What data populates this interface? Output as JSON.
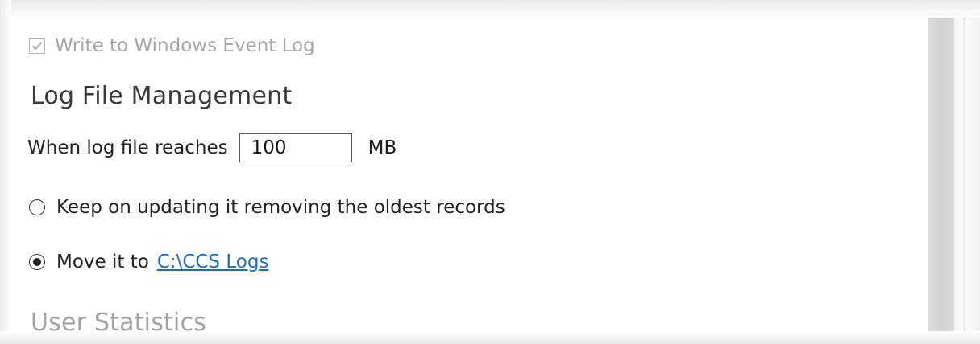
{
  "event_log": {
    "label": "Write to Windows Event Log",
    "checked": true,
    "enabled": false
  },
  "log_file_management": {
    "title": "Log File Management",
    "size_label": "When log file reaches",
    "size_value": "100",
    "size_unit": "MB",
    "options": [
      {
        "label": "Keep on updating it removing the oldest records",
        "selected": false
      },
      {
        "label": "Move it to",
        "selected": true,
        "link": "C:\\CCS Logs"
      }
    ]
  },
  "user_statistics": {
    "title": "User Statistics"
  },
  "colors": {
    "link": "#1f6fb8",
    "disabled_text": "#a6a6a6"
  },
  "icons": {
    "checkbox": "check-icon",
    "radio_selected": "radio-selected-icon",
    "radio_unselected": "radio-unselected-icon"
  }
}
